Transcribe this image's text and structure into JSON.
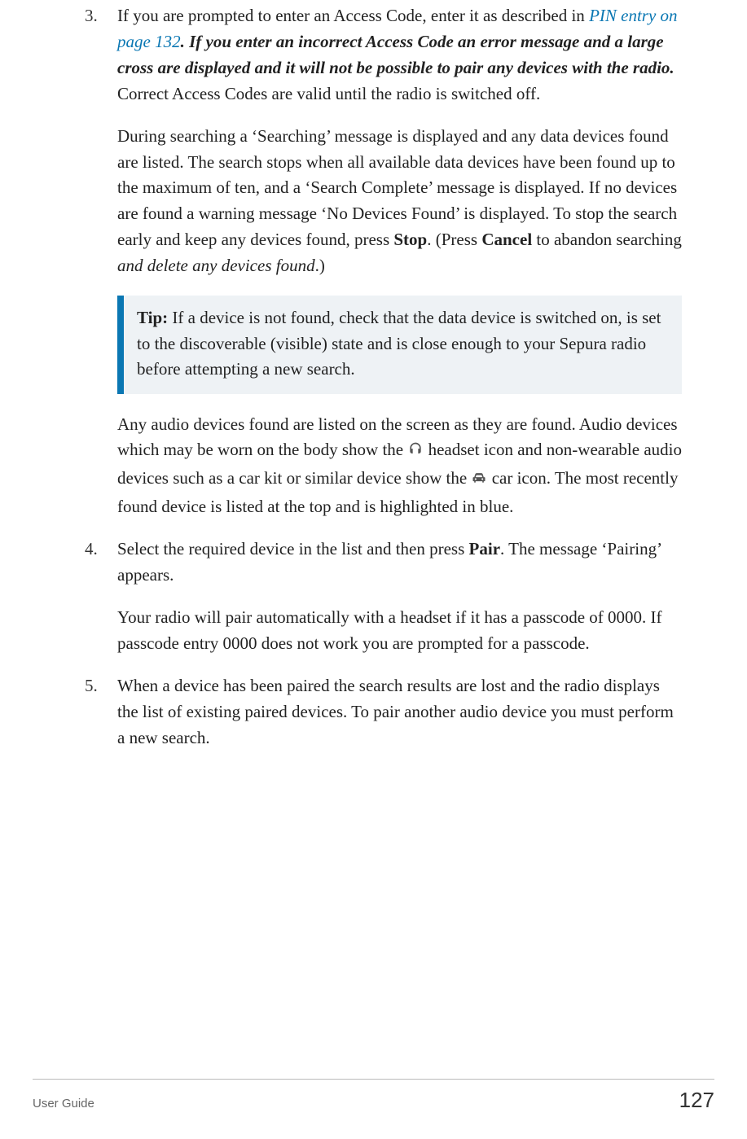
{
  "steps": {
    "3": {
      "num": "3.",
      "p1_a": "If you are prompted to enter an Access Code, enter it as described in ",
      "p1_link": "PIN entry",
      "p1_link_suffix": " on page 132",
      "p1_b": ". If you enter an incorrect Access Code an error message and a large cross are displayed and it will not be possible to pair any devices with the radio.",
      "p1_c": " Correct Access Codes are valid until the radio is switched off.",
      "p2_a": "During searching a ‘Searching’ message is displayed and any data devices found are listed. The search stops when all available data devices have been found up to the maximum of ten, and a ‘Search Complete’ message is displayed. If no devices are found a warning message ‘No Devices Found’ is displayed. To stop the search early and keep any devices found, press ",
      "p2_stop": "Stop",
      "p2_b": ". (Press ",
      "p2_cancel": "Cancel",
      "p2_c": " to abandon searching ",
      "p2_italic": "and delete any devices found",
      "p2_d": ".)",
      "tip_label": "Tip:",
      "tip_body": "  If a device is not found, check that the data device is switched on, is set to the discoverable (visible) state and is close enough to your Sepura radio before attempting a new search.",
      "p3_a": "Any audio devices found are listed on the screen as they are found. Audio devices which may be worn on the body show the ",
      "p3_b": " headset icon and non-wearable audio devices such as a car kit or similar device show the ",
      "p3_c": " car icon. The most recently found device is listed at the top and is highlighted in blue."
    },
    "4": {
      "num": "4.",
      "p1_a": "Select the required device in the list and then press ",
      "p1_pair": "Pair",
      "p1_b": ". The message ‘Pairing’ appears.",
      "p2": "Your radio will pair automatically with a headset if it has a passcode of 0000. If passcode entry 0000 does not work you are prompted for a passcode."
    },
    "5": {
      "num": "5.",
      "p1": "When a device has been paired the search results are lost and the radio displays the list of existing paired devices. To pair another audio device you must perform a new search."
    }
  },
  "footer": {
    "title": "User Guide",
    "page": "127"
  }
}
